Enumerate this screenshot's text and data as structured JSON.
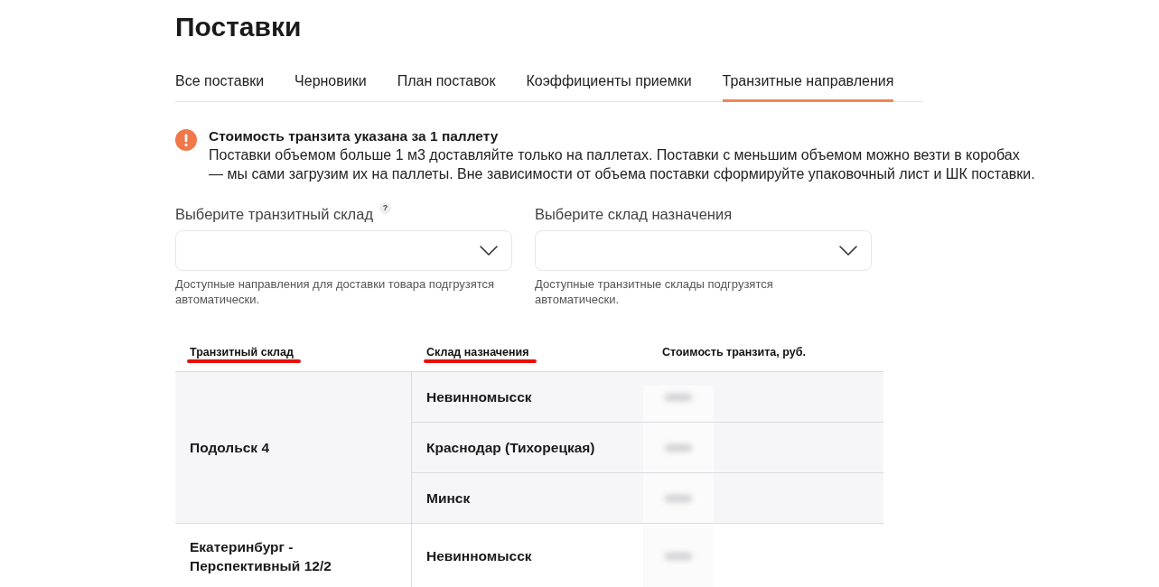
{
  "page": {
    "title": "Поставки"
  },
  "tabs": [
    {
      "label": "Все поставки",
      "selected": false
    },
    {
      "label": "Черновики",
      "selected": false
    },
    {
      "label": "План поставок",
      "selected": false
    },
    {
      "label": "Коэффициенты приемки",
      "selected": false
    },
    {
      "label": "Транзитные направления",
      "selected": true
    }
  ],
  "alert": {
    "title": "Стоимость транзита указана за 1 паллету",
    "text": "Поставки объемом больше 1 м3 доставляйте только на паллетах. Поставки с меньшим объемом можно везти в коробах — мы сами загрузим их на паллеты. Вне зависимости от объема поставки сформируйте упаковочный лист и ШК поставки."
  },
  "filters": [
    {
      "label": "Выберите транзитный склад",
      "help": "?",
      "hint": "Доступные направления для доставки товара подгрузятся автоматически."
    },
    {
      "label": "Выберите склад назначения",
      "hint": "Доступные транзитные склады подгрузятся автоматически."
    }
  ],
  "table": {
    "columns": [
      {
        "label": "Транзитный склад",
        "underlined": true
      },
      {
        "label": "Склад назначения",
        "underlined": true
      },
      {
        "label": "Стоимость транзита, руб.",
        "underlined": false
      }
    ],
    "rows": [
      {
        "transit": "Подольск 4",
        "highlighted": true,
        "destinations": [
          {
            "name": "Невинномысск",
            "cost_hidden": true
          },
          {
            "name": "Краснодар (Тихорецкая)",
            "cost_hidden": true
          },
          {
            "name": "Минск",
            "cost_hidden": true
          }
        ]
      },
      {
        "transit": "Екатеринбург - Перспективный 12/2",
        "highlighted": false,
        "destinations": [
          {
            "name": "Невинномысск",
            "cost_hidden": true
          }
        ]
      }
    ]
  }
}
